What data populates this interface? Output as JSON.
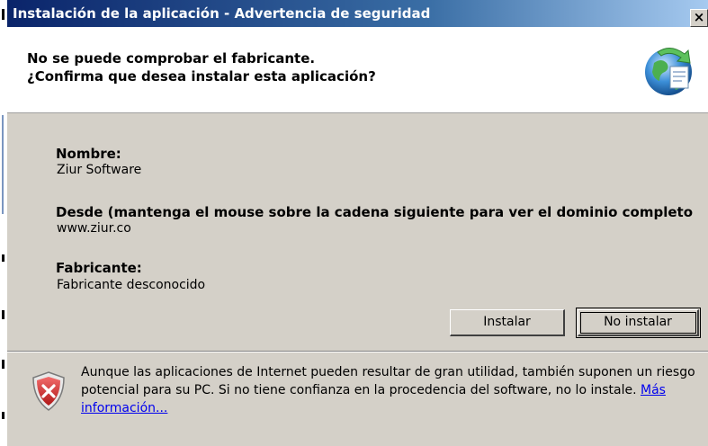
{
  "window": {
    "title": "Instalación de la aplicación - Advertencia de seguridad",
    "close_label": "×"
  },
  "header": {
    "line1": "No se puede comprobar el fabricante.",
    "line2": "¿Confirma que desea instalar esta aplicación?",
    "icon": "application-install-icon"
  },
  "fields": {
    "name_label": "Nombre:",
    "name_value": "Ziur Software",
    "from_label": "Desde (mantenga el mouse sobre la cadena siguiente para ver el dominio completo",
    "from_value": "www.ziur.co",
    "publisher_label": "Fabricante:",
    "publisher_value": "Fabricante desconocido"
  },
  "buttons": {
    "install": "Instalar",
    "dont_install": "No instalar"
  },
  "warning": {
    "icon": "security-shield-error-icon",
    "text": "Aunque las aplicaciones de Internet pueden resultar de gran utilidad, también suponen un riesgo potencial para su PC. Si no tiene confianza en la procedencia del software, no lo instale.",
    "link": "Más información..."
  },
  "colors": {
    "title_bar_start": "#0a246a",
    "title_bar_end": "#a6caf0",
    "dialog_bg": "#d4d0c8",
    "link": "#0000ee"
  }
}
